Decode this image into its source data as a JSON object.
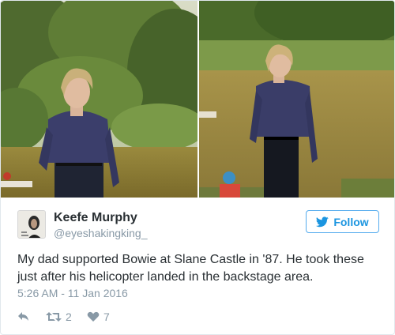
{
  "media": {
    "photos": [
      {
        "description_icon": "photo-left"
      },
      {
        "description_icon": "photo-right"
      }
    ]
  },
  "user": {
    "display_name": "Keefe Murphy",
    "handle": "@eyeshakingking_"
  },
  "follow": {
    "label": "Follow",
    "icon": "twitter-bird-icon",
    "color": "#1b95e0"
  },
  "tweet": {
    "text_lines": [
      "My dad supported Bowie at Slane Castle in '87. He took these",
      "just after his helicopter landed in the backstage area."
    ],
    "timestamp": "5:26 AM - 11 Jan 2016"
  },
  "actions": {
    "reply_icon": "reply-icon",
    "retweet_icon": "retweet-icon",
    "retweet_count": "2",
    "like_icon": "heart-icon",
    "like_count": "7"
  }
}
